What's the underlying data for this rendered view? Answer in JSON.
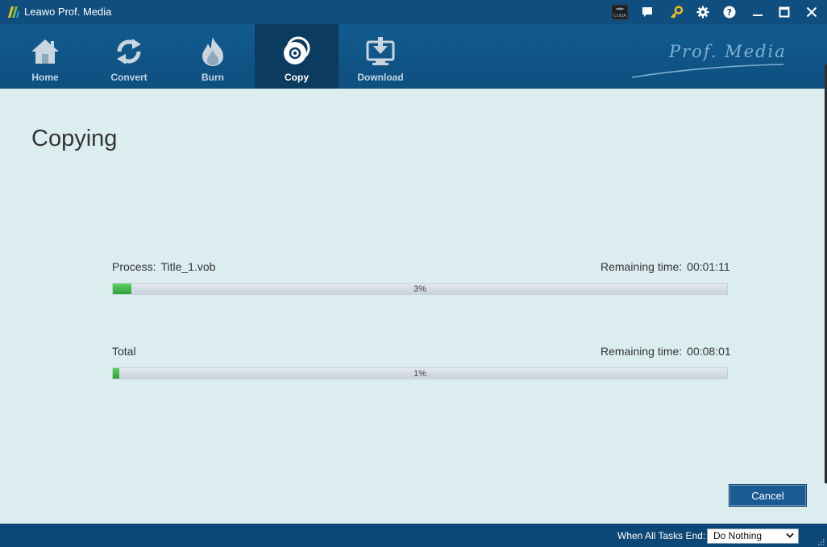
{
  "window": {
    "title": "Leawo Prof. Media",
    "controls": [
      "cuda-icon",
      "chat-icon",
      "key-icon",
      "gear-icon",
      "help-icon",
      "minimize-icon",
      "maximize-icon",
      "close-icon"
    ],
    "cuda_label": "CUDA"
  },
  "nav": {
    "items": [
      {
        "label": "Home",
        "icon": "home-icon",
        "active": false
      },
      {
        "label": "Convert",
        "icon": "convert-icon",
        "active": false
      },
      {
        "label": "Burn",
        "icon": "burn-icon",
        "active": false
      },
      {
        "label": "Copy",
        "icon": "copy-disc-icon",
        "active": true
      },
      {
        "label": "Download",
        "icon": "download-icon",
        "active": false
      }
    ],
    "brand": "Prof. Media"
  },
  "main": {
    "title": "Copying",
    "process": {
      "label": "Process:",
      "file": "Title_1.vob",
      "remaining_label": "Remaining time:",
      "remaining": "00:01:11",
      "percent_text": "3%",
      "percent": 3
    },
    "total": {
      "label": "Total",
      "remaining_label": "Remaining time:",
      "remaining": "00:08:01",
      "percent_text": "1%",
      "percent": 1
    },
    "cancel_label": "Cancel"
  },
  "status": {
    "label": "When All Tasks End:",
    "selected": "Do Nothing"
  },
  "colors": {
    "titlebar": "#0f4e7e",
    "navbar": "#125b8f",
    "nav_active": "#0c3b60",
    "background": "#dcedf0",
    "progress_fill": "#3cb043",
    "key_icon": "#f2c21b"
  }
}
